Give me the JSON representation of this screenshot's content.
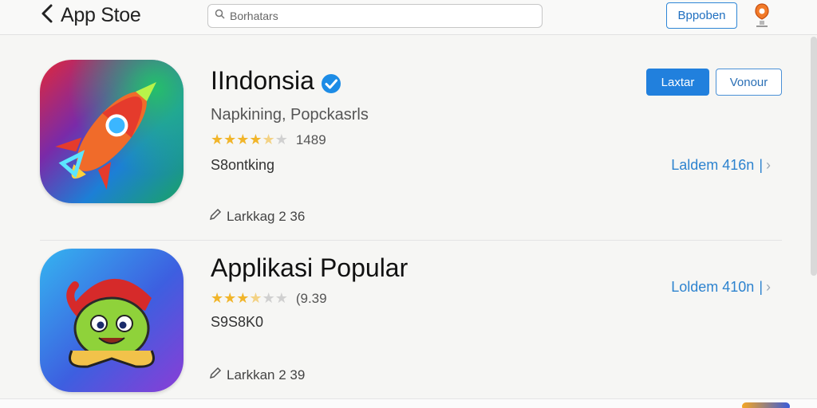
{
  "header": {
    "back_label": "App Stoe",
    "search_placeholder": "Borhatars",
    "top_button_label": "Bppoben"
  },
  "apps": [
    {
      "name": "IIndonsia",
      "verified": true,
      "subtitle": "Napkining, Popckasrls",
      "stars": 4.5,
      "rating_count": "1489",
      "meta": "S8ontking",
      "primary_button": "Laxtar",
      "secondary_button": "Vonour",
      "link_label": "Laldem 416n",
      "footnote": "Larkkag 2 36",
      "icon": "rocket-icon",
      "icon_colors": [
        "#e2283c",
        "#6a2bb0",
        "#22a05a",
        "#2a8bd8"
      ]
    },
    {
      "name": "Applikasi Popular",
      "verified": false,
      "subtitle": "",
      "stars": 3.5,
      "rating_count": "(9.39",
      "meta": "S9S8K0",
      "link_label": "Loldem 410n",
      "footnote": "Larkkan 2 39",
      "icon": "cartoon-character-icon",
      "icon_colors": [
        "#4fb0ef",
        "#8a3fd6",
        "#d62a2a",
        "#8fd23a"
      ]
    }
  ]
}
